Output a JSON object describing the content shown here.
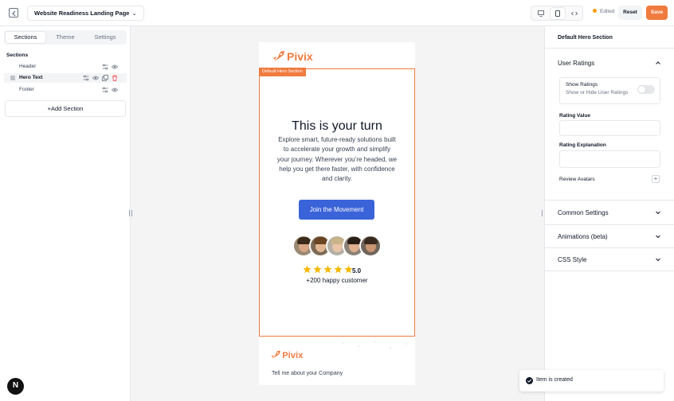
{
  "topbar": {
    "page_title": "Website Readiness Landing Page",
    "edited_label": "Edited",
    "reset_label": "Reset",
    "save_label": "Save",
    "accent": "#f07b3f"
  },
  "left_panel": {
    "tabs": [
      "Sections",
      "Theme",
      "Settings"
    ],
    "active_tab": "Sections",
    "sections_heading": "Sections",
    "sections": [
      {
        "label": "Header"
      },
      {
        "label": "Hero Text",
        "active": true
      },
      {
        "label": "Footer"
      }
    ],
    "add_section_label": "Add Section"
  },
  "canvas": {
    "brand": "Pivix",
    "hero_tag": "Default Hero Section",
    "hero_title": "This is your turn",
    "hero_description": "Explore smart, future-ready solutions built to accelerate your growth and simplify your journey. Wherever you’re headed, we help you get there faster, with confidence and clarity.",
    "cta_label": "Join the Movement",
    "rating_value": "5.0",
    "rating_stars": 5,
    "happy_customers": "+200 happy customer",
    "footer_text": "Tell me about your Company",
    "cta_color": "#3b63d9"
  },
  "right_panel": {
    "title": "Default Hero Section",
    "user_ratings_label": "User Ratings",
    "show_ratings_label": "Show Ratings",
    "show_ratings_sub": "Show or Hide User Ratings",
    "show_ratings_on": false,
    "rating_value_label": "Rating Value",
    "rating_value": "",
    "rating_explanation_label": "Rating Explanation",
    "rating_explanation": "",
    "review_avatars_label": "Review Avatars",
    "common_settings_label": "Common Settings",
    "animations_label": "Animations (beta)",
    "css_style_label": "CSS Style"
  },
  "toast": {
    "message": "Item is created"
  }
}
